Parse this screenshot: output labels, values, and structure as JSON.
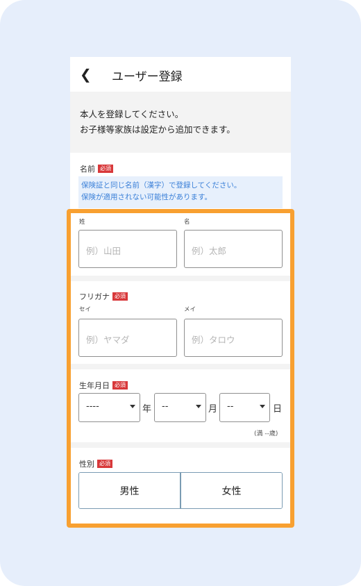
{
  "header": {
    "back_icon": "chevron-left-icon",
    "title": "ユーザー登録"
  },
  "intro": {
    "line1": "本人を登録してください。",
    "line2": "お子様等家族は設定から追加できます。"
  },
  "required_badge": "必須",
  "name_section": {
    "label": "名前",
    "notice_line1": "保険証と同じ名前（漢字）で登録してください。",
    "notice_line2": "保険が適用されない可能性があります。",
    "last_label": "姓",
    "last_placeholder": "例）山田",
    "first_label": "名",
    "first_placeholder": "例）太郎"
  },
  "kana_section": {
    "label": "フリガナ",
    "last_label": "セイ",
    "last_placeholder": "例）ヤマダ",
    "first_label": "メイ",
    "first_placeholder": "例）タロウ"
  },
  "birth_section": {
    "label": "生年月日",
    "year_value": "----",
    "year_unit": "年",
    "month_value": "--",
    "month_unit": "月",
    "day_value": "--",
    "day_unit": "日",
    "age_text": "(満 --歳)"
  },
  "gender_section": {
    "label": "性別",
    "male": "男性",
    "female": "女性"
  },
  "colors": {
    "required": "#d8383a",
    "highlight": "#f8a031",
    "notice_bg": "#e7f0fc",
    "notice_text": "#3b80d8"
  }
}
